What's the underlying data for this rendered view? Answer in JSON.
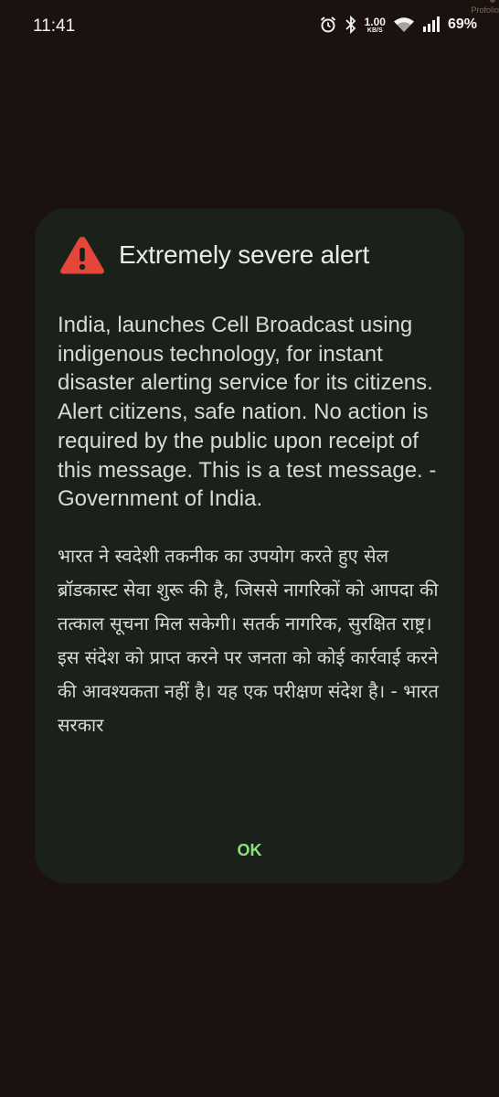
{
  "status_bar": {
    "time": "11:41",
    "net_speed_value": "1.00",
    "net_speed_unit": "KB/S",
    "battery": "69%",
    "icons": [
      "alarm-icon",
      "bluetooth-icon",
      "wifi-icon",
      "signal-icon"
    ],
    "watermark": "Profolio"
  },
  "dialog": {
    "title": "Extremely severe alert",
    "icon": "warning-triangle-icon",
    "icon_color": "#e5463a",
    "message_en": "India, launches Cell Broadcast using indigenous technology, for instant disaster alerting service for its citizens. Alert citizens, safe nation. No action is required by the public upon receipt of this message. This is a test message. - Government of India.",
    "message_hi": "भारत ने स्वदेशी तकनीक का उपयोग करते हुए सेल ब्रॉडकास्ट सेवा शुरू की है, जिससे नागरिकों को आपदा की तत्काल सूचना मिल सकेगी। सतर्क नागरिक, सुरक्षित राष्ट्र। इस संदेश को प्राप्त करने पर जनता को कोई कार्रवाई करने की आवश्यकता नहीं है। यह एक परीक्षण संदेश है। - भारत सरकार",
    "ok_label": "OK",
    "ok_color": "#8fe07a"
  }
}
